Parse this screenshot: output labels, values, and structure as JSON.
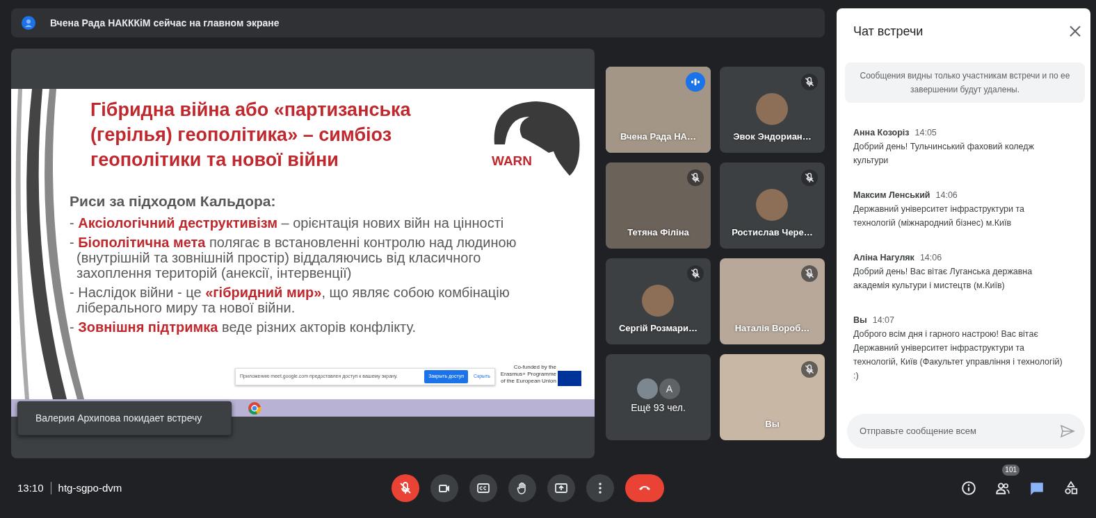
{
  "banner": {
    "text": "Вчена Рада НАКККіМ сейчас на главном экране"
  },
  "slide": {
    "title": "Гібридна війна або «партизанська (герілья) геополітика» – симбіоз геополітики та нової війни",
    "logo_text": "WARN",
    "subtitle": "Риси за підходом Кальдора:",
    "bullets": [
      "- **Аксіологічний деструктивізм** – орієнтація нових війн на цінності",
      "- **Біополітична мета** полягає в встановленні контролю над людиною (внутрішній та зовнішній простір) віддаляючись від класичного захоплення територій (анексії, інтервенції)",
      "- Наслідок війни - це **«гібридний мир»**,  що являє собою комбінацію ліберального миру та нової війни.",
      "- **Зовнішня підтримка** веде різних акторів конфлікту."
    ],
    "share_notice": {
      "text": "Приложению meet.google.com предоставлен доступ к вашему экрану.",
      "stop_button": "Закрыть доступ",
      "hide_link": "Скрыть"
    },
    "funding_note": "Co-funded by the Erasmus+ Programme of the European Union"
  },
  "toast": "Валерия Архипова покидает встречу",
  "tiles": [
    {
      "kind": "video",
      "name": "Вчена Рада НА…",
      "muted": false,
      "speaking": true
    },
    {
      "kind": "avatar",
      "name": "Эвок Эндориан…",
      "muted": true,
      "speaking": false
    },
    {
      "kind": "video",
      "name": "Тетяна Філіна",
      "muted": true,
      "speaking": false
    },
    {
      "kind": "avatar",
      "name": "Ростислав Чере…",
      "muted": true,
      "speaking": false
    },
    {
      "kind": "avatar",
      "name": "Сергій Розмари…",
      "muted": true,
      "speaking": false
    },
    {
      "kind": "video",
      "name": "Наталія Вороб…",
      "muted": true,
      "speaking": false
    },
    {
      "kind": "more",
      "name": "Ещё 93 чел.",
      "avatar_letter": "A",
      "muted": false,
      "speaking": false
    },
    {
      "kind": "video",
      "name": "Вы",
      "muted": true,
      "speaking": false
    }
  ],
  "chat": {
    "title": "Чат встречи",
    "notice": "Сообщения видны только участникам встречи и по ее завершении будут удалены.",
    "messages": [
      {
        "sender": "Анна Козоріз",
        "time": "14:05",
        "text": "Добрий день! Тульчинський фаховий коледж культури"
      },
      {
        "sender": "Максим Ленський",
        "time": "14:06",
        "text": "Державний університет інфраструктури та технологій (міжнародний бізнес) м.Київ"
      },
      {
        "sender": "Аліна Нагуляк",
        "time": "14:06",
        "text": "Добрий день! Вас вітає Луганська державна академія культури і мистецтв (м.Київ)"
      },
      {
        "sender": "Вы",
        "time": "14:07",
        "text": "Доброго всім дня і гарного настрою! Вас вітає Державний університет інфраструктури та технологій, Київ (Факультет управління і технологій) :)"
      }
    ],
    "input": {
      "placeholder": "Отправьте сообщение всем"
    }
  },
  "bottom_bar": {
    "time": "13:10",
    "meeting_code": "htg-sgpo-dvm",
    "controls": [
      {
        "kind": "mic",
        "muted": true
      },
      {
        "kind": "camera"
      },
      {
        "kind": "captions"
      },
      {
        "kind": "hand"
      },
      {
        "kind": "present"
      },
      {
        "kind": "more"
      },
      {
        "kind": "end_call"
      }
    ],
    "side_buttons": [
      {
        "kind": "info",
        "selected": false
      },
      {
        "kind": "people",
        "badge": "101",
        "selected": false
      },
      {
        "kind": "chat",
        "selected": true
      },
      {
        "kind": "activities",
        "selected": false
      }
    ]
  }
}
